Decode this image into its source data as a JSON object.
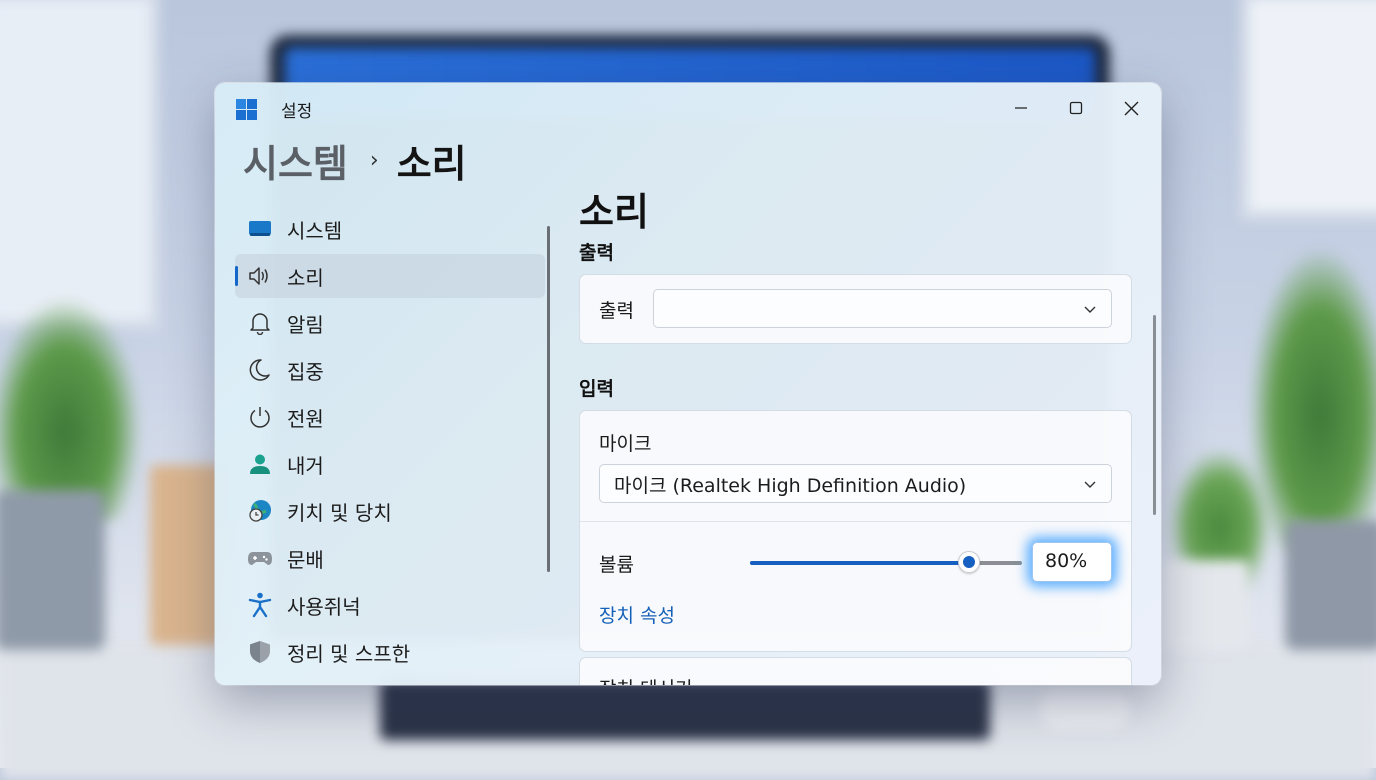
{
  "window": {
    "title": "설정",
    "controls": {
      "minimize": "minimize",
      "maximize": "maximize",
      "close": "close"
    }
  },
  "breadcrumb": {
    "parent": "시스템",
    "separator": "›",
    "current": "소리"
  },
  "sidebar": {
    "items": [
      {
        "label": "시스템",
        "icon": "display-icon",
        "selected": false
      },
      {
        "label": "소리",
        "icon": "speaker-icon",
        "selected": true
      },
      {
        "label": "알림",
        "icon": "bell-icon",
        "selected": false
      },
      {
        "label": "집중",
        "icon": "moon-icon",
        "selected": false
      },
      {
        "label": "전원",
        "icon": "power-icon",
        "selected": false
      },
      {
        "label": "내거",
        "icon": "person-icon",
        "selected": false
      },
      {
        "label": "키치 및 당치",
        "icon": "globe-clock-icon",
        "selected": false
      },
      {
        "label": "문배",
        "icon": "gamepad-icon",
        "selected": false
      },
      {
        "label": "사용쥐넉",
        "icon": "accessibility-icon",
        "selected": false
      },
      {
        "label": "정리 및 스프한",
        "icon": "shield-icon",
        "selected": false
      }
    ]
  },
  "content": {
    "title": "소리",
    "output": {
      "section_label": "출력",
      "row_label": "출력",
      "dropdown_value": ""
    },
    "input": {
      "section_label": "입력",
      "mic_label": "마이크",
      "mic_dropdown_value": "마이크 (Realtek High Definition Audio)",
      "volume_label": "볼륨",
      "volume_percent": 80,
      "volume_text": "80%",
      "device_properties_link": "장치 속성"
    },
    "next_card_label": "장치 테서기"
  },
  "colors": {
    "accent": "#1560c0",
    "focus_glow": "#2896ff",
    "link": "#1560b8"
  }
}
